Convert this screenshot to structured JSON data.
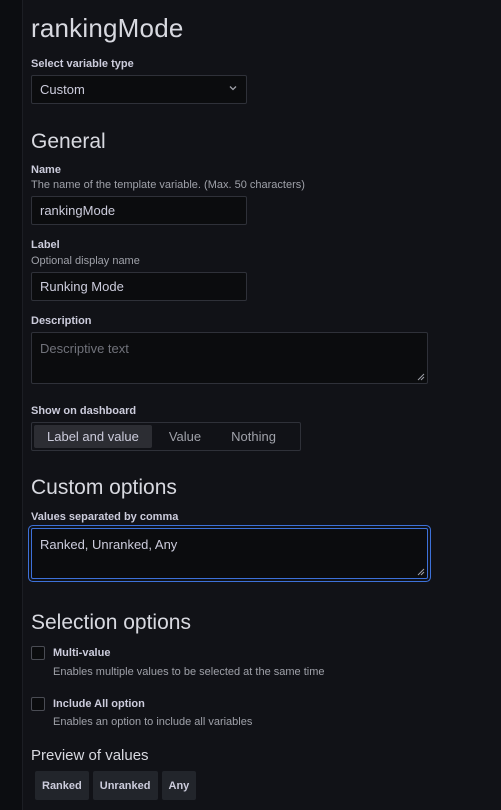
{
  "variable_name_title": "rankingMode",
  "type_select": {
    "label": "Select variable type",
    "value": "Custom",
    "chevron_icon": "chevron-down-icon"
  },
  "general": {
    "title": "General",
    "name": {
      "label": "Name",
      "description": "The name of the template variable. (Max. 50 characters)",
      "value": "rankingMode"
    },
    "label_field": {
      "label": "Label",
      "description": "Optional display name",
      "value": "Runking Mode"
    },
    "description_field": {
      "label": "Description",
      "placeholder": "Descriptive text"
    },
    "show_on_dashboard": {
      "label": "Show on dashboard",
      "options": [
        "Label and value",
        "Value",
        "Nothing"
      ],
      "selected": "Label and value"
    }
  },
  "custom_options": {
    "title": "Custom options",
    "values_label": "Values separated by comma",
    "values": "Ranked, Unranked, Any"
  },
  "selection_options": {
    "title": "Selection options",
    "multi_value": {
      "label": "Multi-value",
      "description": "Enables multiple values to be selected at the same time",
      "checked": false
    },
    "include_all": {
      "label": "Include All option",
      "description": "Enables an option to include all variables",
      "checked": false
    }
  },
  "preview": {
    "title": "Preview of values",
    "values": [
      "Ranked",
      "Unranked",
      "Any"
    ]
  },
  "colors": {
    "background": "#111217",
    "input_background": "#0b0c0e",
    "border": "#2f3139",
    "focus": "#3d71d9",
    "text": "#ccccdc",
    "muted": "#9fa1a9"
  }
}
